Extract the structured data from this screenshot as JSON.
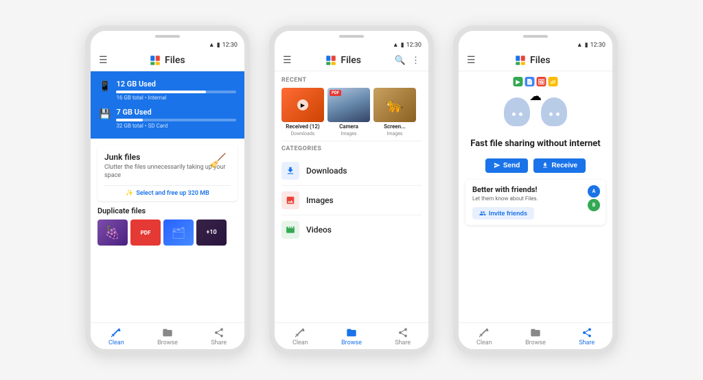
{
  "page": {
    "background": "#f5f5f5"
  },
  "phones": [
    {
      "id": "phone1",
      "status_time": "12:30",
      "app_title": "Files",
      "storage": [
        {
          "label": "12 GB Used",
          "sub": "16 GB total • Internal",
          "fill_pct": 75
        },
        {
          "label": "7 GB Used",
          "sub": "32 GB total • SD Card",
          "fill_pct": 22
        }
      ],
      "junk": {
        "title": "Junk files",
        "desc": "Clutter the files unnecessarily taking up your space",
        "action": "Select and free up 320 MB"
      },
      "duplicate": {
        "title": "Duplicate files"
      },
      "nav": [
        {
          "label": "Clean",
          "active": true,
          "icon": "broom"
        },
        {
          "label": "Browse",
          "active": false,
          "icon": "folder"
        },
        {
          "label": "Share",
          "active": false,
          "icon": "share"
        }
      ]
    },
    {
      "id": "phone2",
      "status_time": "12:30",
      "app_title": "Files",
      "recent_label": "RECENT",
      "recent_items": [
        {
          "name": "Received (12)",
          "sub": "Downloads",
          "type": "video"
        },
        {
          "name": "Camera",
          "sub": "Images",
          "type": "pdf_sky"
        },
        {
          "name": "Screen...",
          "sub": "Images",
          "type": "tiger"
        }
      ],
      "categories_label": "CATEGORIES",
      "categories": [
        {
          "name": "Downloads",
          "icon": "⬇",
          "color": "dl"
        },
        {
          "name": "Images",
          "icon": "🖼",
          "color": "img"
        },
        {
          "name": "Videos",
          "icon": "🎬",
          "color": "vid"
        }
      ],
      "nav": [
        {
          "label": "Clean",
          "active": false,
          "icon": "broom"
        },
        {
          "label": "Browse",
          "active": true,
          "icon": "folder"
        },
        {
          "label": "Share",
          "active": false,
          "icon": "share"
        }
      ]
    },
    {
      "id": "phone3",
      "status_time": "12:30",
      "app_title": "Files",
      "share_title": "Fast file sharing\nwithout internet",
      "send_label": "Send",
      "receive_label": "Receive",
      "friends_title": "Better with friends!",
      "friends_desc": "Let them know about Files.",
      "invite_label": "Invite friends",
      "nav": [
        {
          "label": "Clean",
          "active": false,
          "icon": "broom"
        },
        {
          "label": "Browse",
          "active": false,
          "icon": "folder"
        },
        {
          "label": "Share",
          "active": true,
          "icon": "share"
        }
      ]
    }
  ]
}
